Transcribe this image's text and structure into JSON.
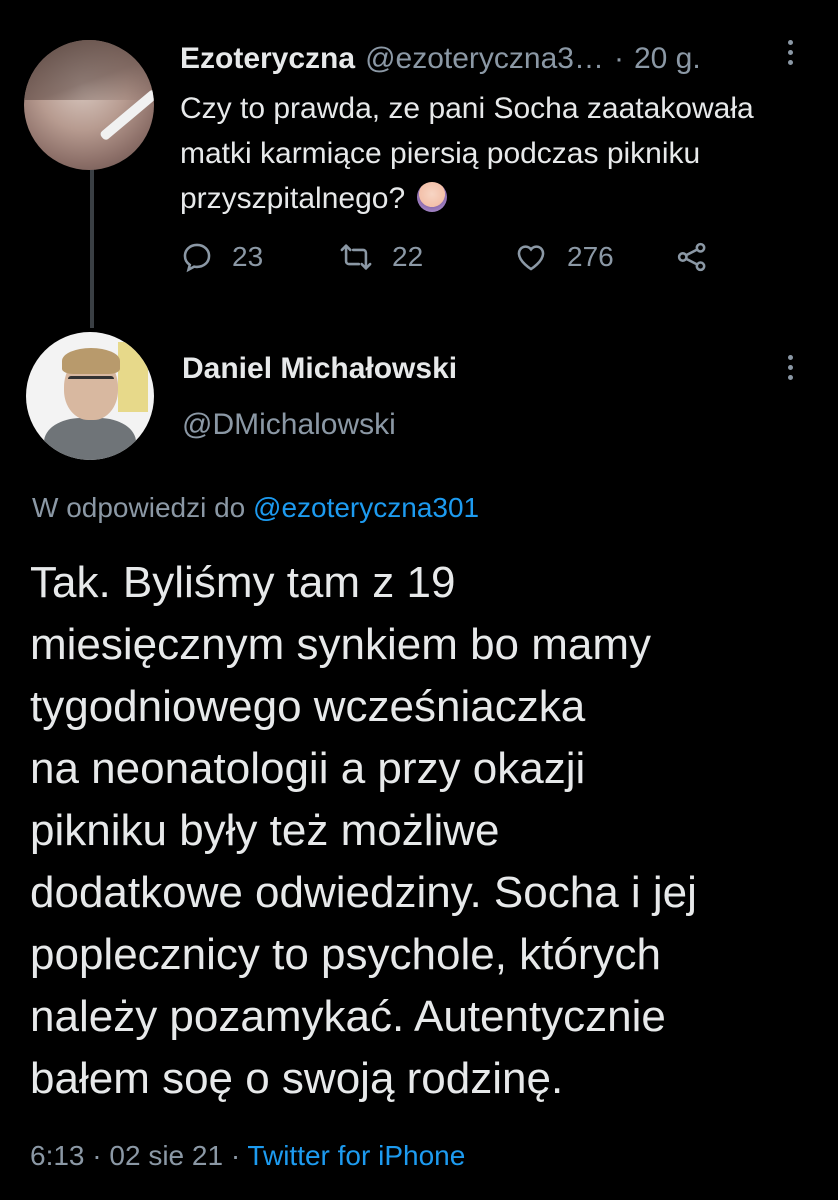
{
  "tweet1": {
    "display_name": "Ezoteryczna",
    "handle": "@ezoteryczna3…",
    "separator": "·",
    "time": "20 g.",
    "text": "Czy to prawda, ze pani Socha zaatakowała matki karmiące piersią podczas pikniku przyszpitalnego?",
    "emoji": "🤦‍♀️",
    "replies": "23",
    "retweets": "22",
    "likes": "276"
  },
  "tweet2": {
    "display_name": "Daniel Michałowski",
    "handle": "@DMichalowski",
    "reply_prefix": "W odpowiedzi do",
    "reply_mention": "@ezoteryczna301",
    "text": "Tak. Byliśmy tam z 19\nmiesięcznym synkiem bo mamy\ntygodniowego wcześniaczka\nna neonatologii a przy okazji\npikniku były też możliwe\ndodatkowe odwiedziny. Socha i jej\npoplecznicy to psychole, których\nnależy pozamykać. Autentycznie\nbałem soę o swoją rodzinę.",
    "time": "6:13",
    "date": "02 sie 21",
    "separator": "·",
    "source": "Twitter for iPhone"
  },
  "icons": {
    "reply": "reply-icon",
    "retweet": "retweet-icon",
    "like": "heart-icon",
    "share": "share-icon",
    "more": "more-vertical-icon"
  },
  "colors": {
    "background": "#000000",
    "text": "#e7e9ea",
    "secondary": "#8b98a5",
    "link": "#1d9bf0"
  }
}
